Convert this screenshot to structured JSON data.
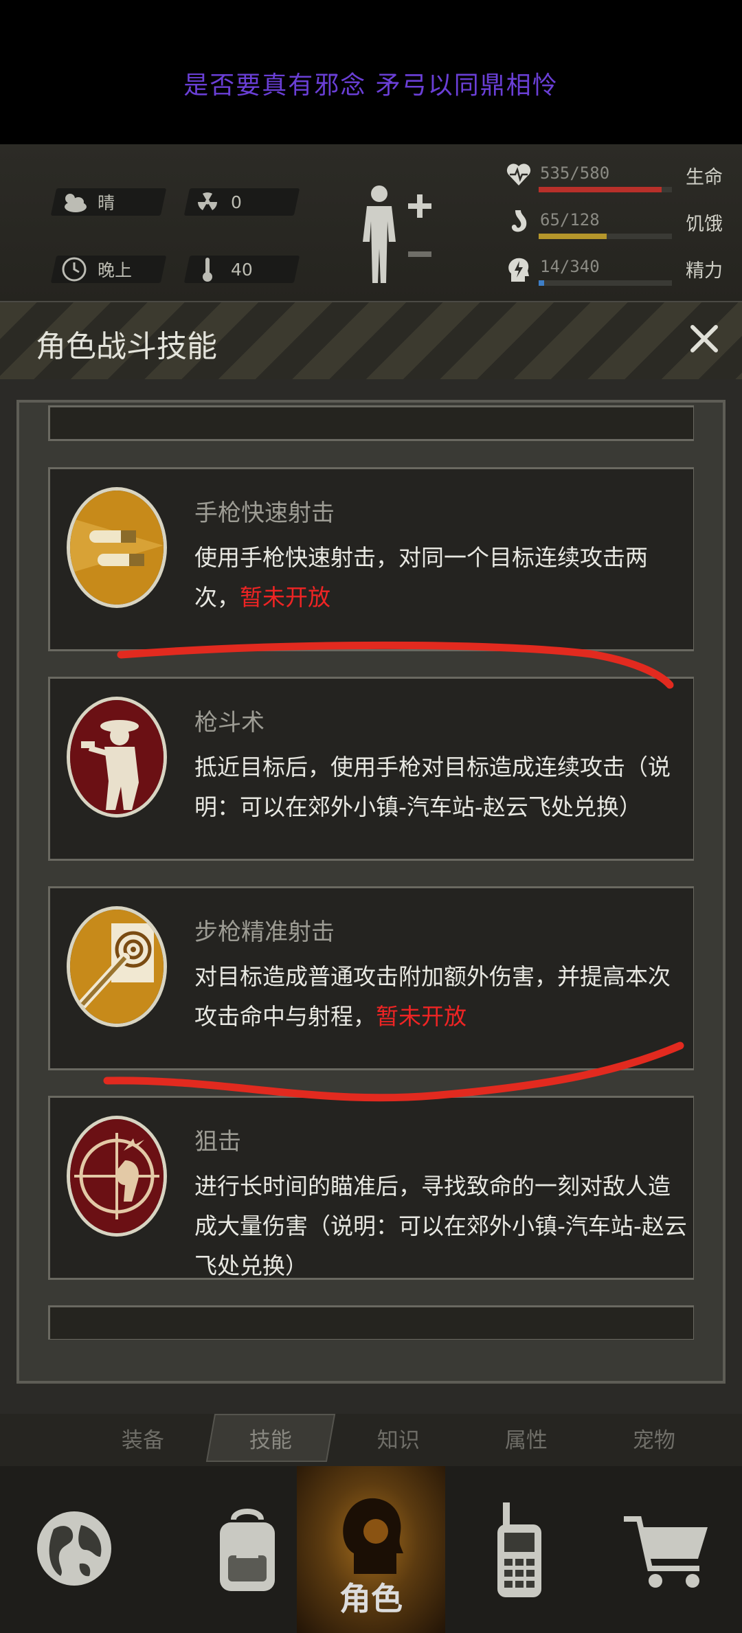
{
  "banner": {
    "text": "是否要真有邪念 矛弓以同鼎相怜"
  },
  "hud": {
    "weather": {
      "icon": "cloudy-weather-icon",
      "label": "晴"
    },
    "radiation": {
      "icon": "radiation-icon",
      "value": "0"
    },
    "time": {
      "icon": "clock-icon",
      "label": "晚上"
    },
    "temperature": {
      "icon": "thermometer-icon",
      "value": "40"
    },
    "stats": [
      {
        "icon": "heart-icon",
        "value": "535/580",
        "label": "生命",
        "fill": 0.922,
        "color": "#b8302a"
      },
      {
        "icon": "stomach-icon",
        "value": "65/128",
        "label": "饥饿",
        "fill": 0.508,
        "color": "#b5962b"
      },
      {
        "icon": "brain-lightning-icon",
        "value": "14/340",
        "label": "精力",
        "fill": 0.041,
        "color": "#3e7fc7"
      }
    ]
  },
  "panel": {
    "title": "角色战斗技能",
    "close_icon": "close-icon",
    "skills": [
      {
        "icon": "bullets-icon",
        "name": "手枪快速射击",
        "desc": "使用手枪快速射击，对同一个目标连续攻击两次，",
        "note": "暂未开放"
      },
      {
        "icon": "gunfighter-icon",
        "name": "枪斗术",
        "desc": "抵近目标后，使用手枪对目标造成连续攻击（说明：可以在郊外小镇-汽车站-赵云飞处兑换）",
        "note": ""
      },
      {
        "icon": "rifle-target-icon",
        "name": "步枪精准射击",
        "desc": "对目标造成普通攻击附加额外伤害，并提高本次攻击命中与射程，",
        "note": "暂未开放"
      },
      {
        "icon": "sniper-crosshair-icon",
        "name": "狙击",
        "desc": "进行长时间的瞄准后，寻找致命的一刻对敌人造成大量伤害（说明：可以在郊外小镇-汽车站-赵云飞处兑换）",
        "note": ""
      }
    ]
  },
  "subtabs": [
    "装备",
    "技能",
    "知识",
    "属性",
    "宠物"
  ],
  "subtab_active": "技能",
  "nav": {
    "items": [
      {
        "icon": "globe-icon",
        "label": ""
      },
      {
        "icon": "backpack-icon",
        "label": ""
      },
      {
        "icon": "character-head-icon",
        "label": "角色"
      },
      {
        "icon": "walkie-talkie-icon",
        "label": ""
      },
      {
        "icon": "shopping-cart-icon",
        "label": ""
      }
    ],
    "active_index": 2
  }
}
